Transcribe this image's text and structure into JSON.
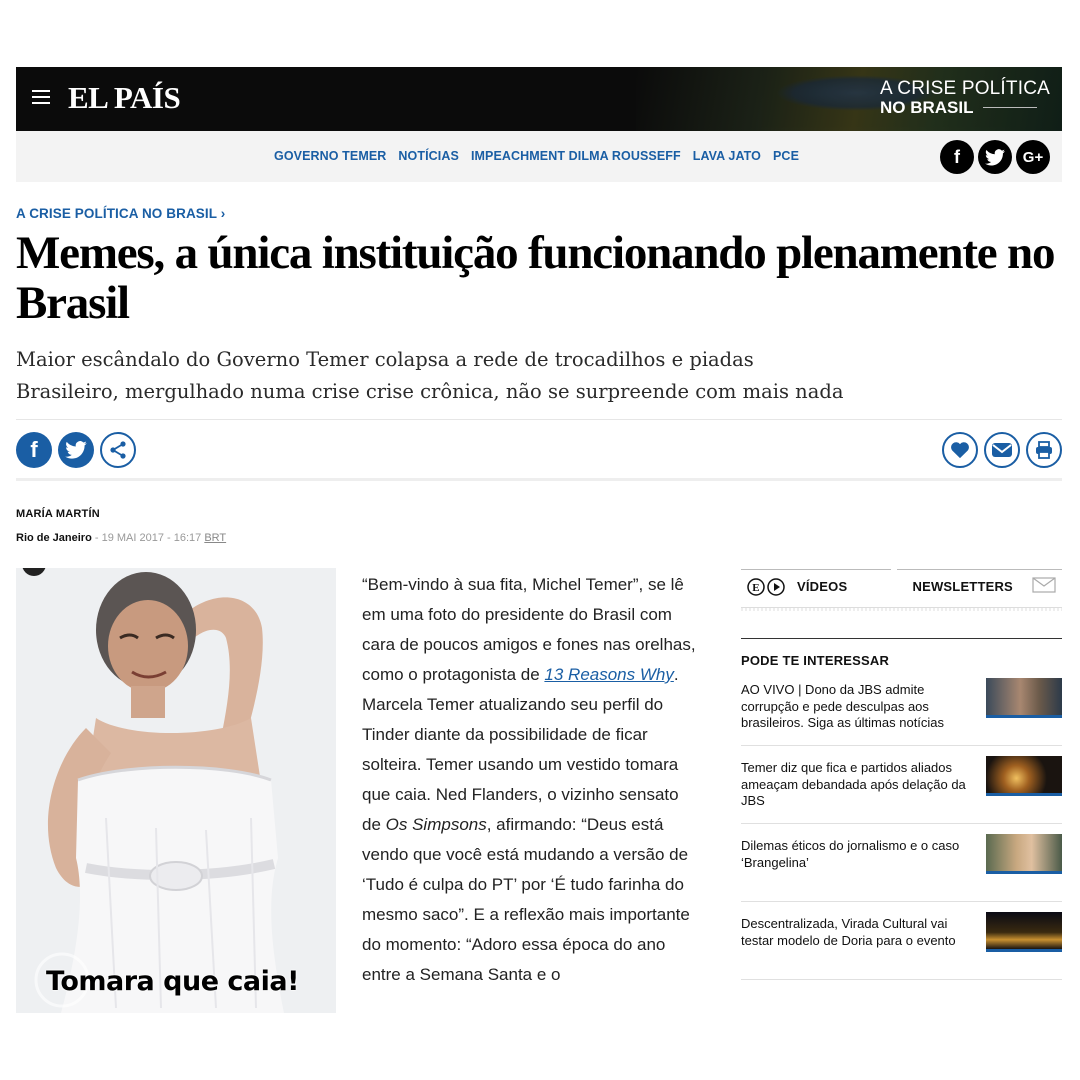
{
  "header": {
    "logo": "EL PAÍS",
    "crisis_line1": "A CRISE POLÍTICA",
    "crisis_line2": "NO BRASIL"
  },
  "nav": {
    "links": [
      "GOVERNO TEMER",
      "NOTÍCIAS",
      "IMPEACHMENT DILMA ROUSSEFF",
      "LAVA JATO",
      "PCE"
    ]
  },
  "article": {
    "kicker": "A CRISE POLÍTICA NO BRASIL ›",
    "headline": "Memes, a única instituição funcionando plenamente no Brasil",
    "subhead_1": "Maior escândalo do Governo Temer colapsa a rede de trocadilhos e piadas",
    "subhead_2": "Brasileiro, mergulhado numa crise crise crônica, não se surpreende com mais nada",
    "author": "MARÍA MARTÍN",
    "location": "Rio de Janeiro",
    "date": " - 19 MAI 2017 - 16:17 ",
    "tz": "BRT",
    "image_caption": "Tomara que caia!",
    "body_1": "“Bem-vindo à sua fita, Michel Temer”, se lê em uma foto do presidente do Brasil com cara de poucos amigos e fones nas orelhas, como o protagonista de ",
    "body_link": "13 Reasons Why",
    "body_2": ". Marcela Temer atualizando seu perfil do Tinder diante da possibilidade de ficar solteira. Temer usando um vestido tomara que caia. Ned Flanders, o vizinho sensato de ",
    "body_italic": "Os Simpsons",
    "body_3": ", afirmando: “Deus está vendo que você está mudando a versão de ‘Tudo é culpa do PT’ por ‘É tudo farinha do mesmo saco”. E a reflexão mais importante do momento: “Adoro essa época do ano entre a Semana Santa e o"
  },
  "sidebar": {
    "videos_label": "VÍDEOS",
    "newsletters_label": "NEWSLETTERS",
    "pode_title": "PODE TE INTERESSAR",
    "items": [
      {
        "text": "AO VIVO | Dono da JBS admite corrupção e pede desculpas aos brasileiros. Siga as últimas notícias"
      },
      {
        "text": "Temer diz que fica e partidos aliados ameaçam debandada após delação da JBS"
      },
      {
        "text": "Dilemas éticos do jornalismo e o caso ‘Brangelina’"
      },
      {
        "text": "Descentralizada, Virada Cultural vai testar modelo de Doria para o evento"
      }
    ]
  },
  "colors": {
    "accent": "#1a5ea4",
    "header_bg": "#0b0b0b",
    "nav_bg": "#f3f3f3"
  },
  "icons": [
    "menu-icon",
    "facebook-icon",
    "twitter-icon",
    "google-plus-icon",
    "share-icon",
    "heart-icon",
    "mail-icon",
    "print-icon",
    "video-icon",
    "envelope-icon"
  ]
}
